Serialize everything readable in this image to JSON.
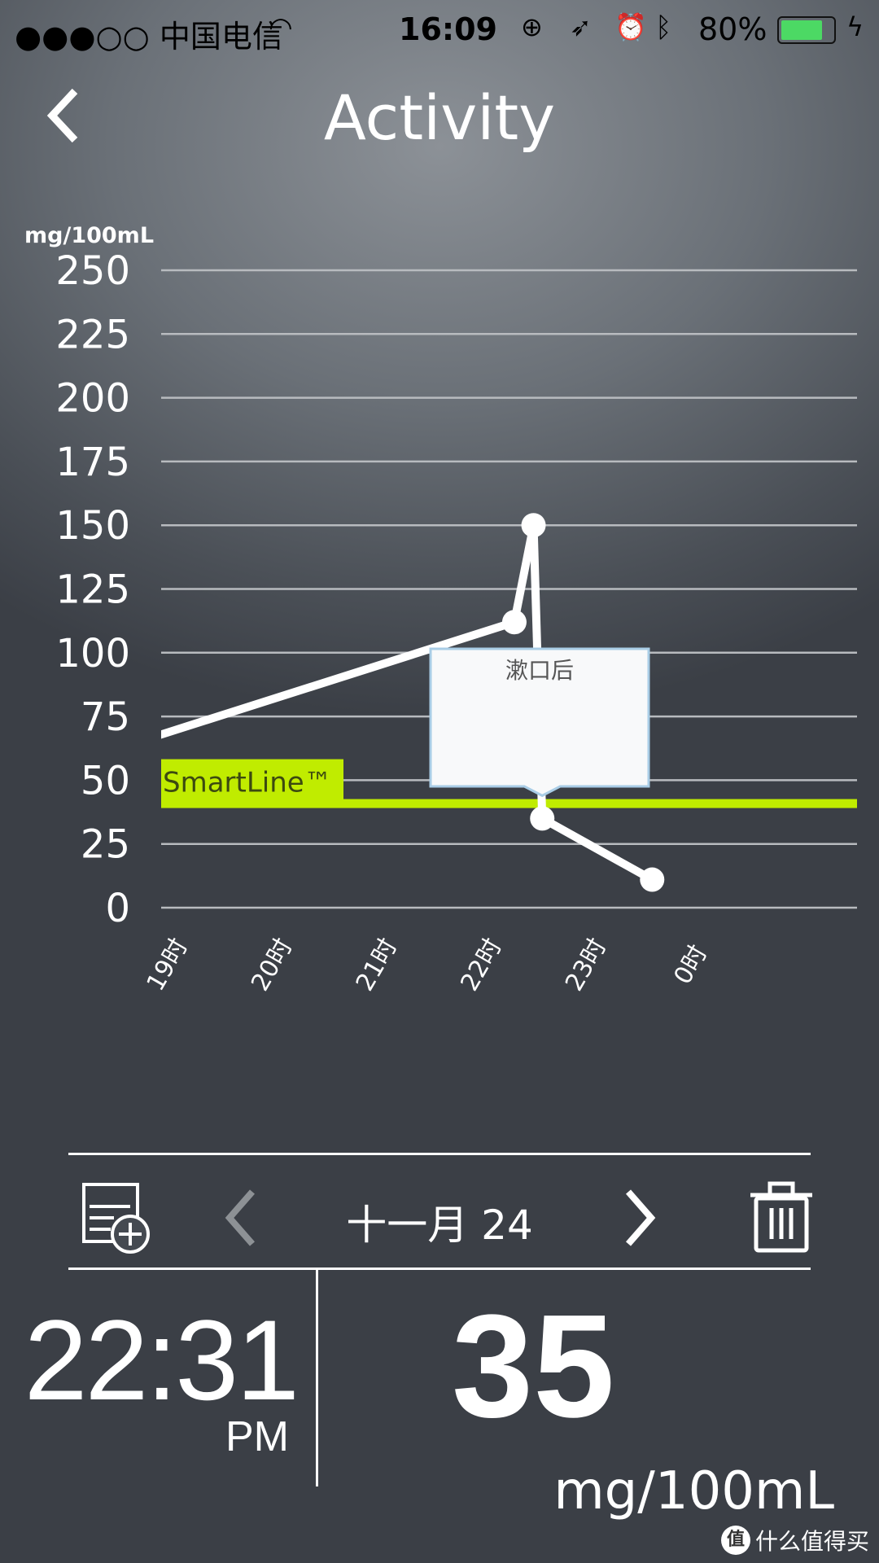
{
  "status_bar": {
    "carrier": "●●●○○ 中国电信",
    "time": "16:09",
    "battery": "80%",
    "battery_level": 0.8,
    "battery_color": "#4cd964"
  },
  "header": {
    "title": "Activity",
    "back_icon": "chevron-left-icon"
  },
  "chart_data": {
    "type": "line",
    "ylabel": "mg/100mL",
    "ylim": [
      0,
      250
    ],
    "yticks": [
      "250",
      "225",
      "200",
      "175",
      "150",
      "125",
      "100",
      "75",
      "50",
      "25",
      "0"
    ],
    "xticks": [
      "19时",
      "20时",
      "21时",
      "22时",
      "23时",
      "0时"
    ],
    "grid": true,
    "series": [
      {
        "points": [
          {
            "time": "18:30",
            "value": 63
          },
          {
            "time": "22:15",
            "value": 112
          },
          {
            "time": "22:26",
            "value": 150
          },
          {
            "time": "22:31",
            "value": 35
          },
          {
            "time": "23:34",
            "value": 11
          }
        ]
      }
    ],
    "threshold": {
      "label": "SmartLine™",
      "value": 41,
      "color": "#c0ec00"
    },
    "tooltip": {
      "text": "漱口后",
      "time": "22:31",
      "value": 35
    }
  },
  "nav": {
    "date": "十一月 24",
    "add_note_icon": "add-note-icon",
    "prev_icon": "chevron-left-icon",
    "next_icon": "chevron-right-icon",
    "delete_icon": "trash-icon"
  },
  "reading": {
    "time": "22:31",
    "ampm": "PM",
    "value": "35",
    "unit": "mg/100mL"
  },
  "watermark": {
    "logo": "值",
    "text": "什么值得买"
  }
}
